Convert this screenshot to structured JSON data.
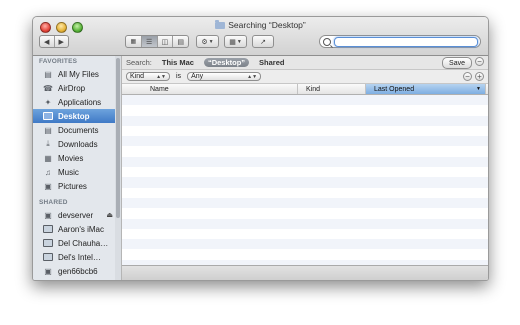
{
  "window": {
    "title": "Searching “Desktop”"
  },
  "toolbar": {
    "back_icon": "back-arrow-icon",
    "forward_icon": "forward-arrow-icon",
    "views": [
      "icon-view",
      "list-view",
      "column-view",
      "cover-flow-view"
    ],
    "active_view_index": 1,
    "action_icon": "gear-icon",
    "arrange_icon": "grid-arrange-icon",
    "share_icon": "share-icon",
    "search_value": ""
  },
  "sidebar": {
    "favorites_header": "FAVORITES",
    "favorites": [
      {
        "label": "All My Files",
        "icon": "all-files-icon"
      },
      {
        "label": "AirDrop",
        "icon": "airdrop-icon"
      },
      {
        "label": "Applications",
        "icon": "applications-icon"
      },
      {
        "label": "Desktop",
        "icon": "desktop-icon",
        "selected": true
      },
      {
        "label": "Documents",
        "icon": "documents-icon"
      },
      {
        "label": "Downloads",
        "icon": "downloads-icon"
      },
      {
        "label": "Movies",
        "icon": "movies-icon"
      },
      {
        "label": "Music",
        "icon": "music-icon"
      },
      {
        "label": "Pictures",
        "icon": "pictures-icon"
      }
    ],
    "shared_header": "SHARED",
    "shared": [
      {
        "label": "devserver",
        "icon": "server-icon",
        "eject": "⏏"
      },
      {
        "label": "Aaron's iMac",
        "icon": "imac-icon"
      },
      {
        "label": "Del Chauha…",
        "icon": "display-icon"
      },
      {
        "label": "Del's Intel…",
        "icon": "display-icon"
      },
      {
        "label": "gen66bcb6",
        "icon": "server-icon"
      }
    ]
  },
  "scope": {
    "label": "Search:",
    "options": [
      "This Mac",
      "“Desktop”",
      "Shared"
    ],
    "active_index": 1,
    "save_label": "Save",
    "remove_symbol": "−"
  },
  "rule": {
    "attribute": "Kind",
    "operator": "is",
    "value": "Any",
    "remove_symbol": "−",
    "add_symbol": "+"
  },
  "columns": [
    {
      "label": "Name"
    },
    {
      "label": "Kind"
    },
    {
      "label": "Last Opened",
      "sorted": true
    }
  ]
}
